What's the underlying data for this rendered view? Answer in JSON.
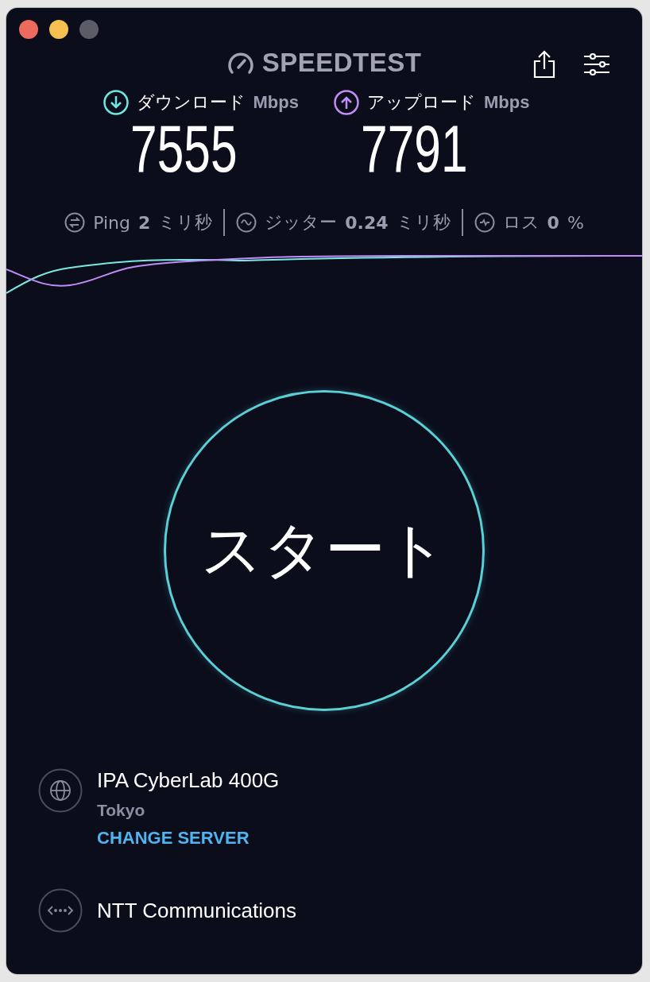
{
  "logo": {
    "text": "SPEEDTEST"
  },
  "metrics": [
    {
      "kind": "download",
      "label": "ダウンロード",
      "unit": "Mbps",
      "value": "7555"
    },
    {
      "kind": "upload",
      "label": "アップロード",
      "unit": "Mbps",
      "value": "7791"
    }
  ],
  "stats": [
    {
      "kind": "ping",
      "label": "Ping",
      "value": "2",
      "unit": "ミリ秒"
    },
    {
      "kind": "jitter",
      "label": "ジッター",
      "value": "0.24",
      "unit": "ミリ秒"
    },
    {
      "kind": "loss",
      "label": "ロス",
      "value": "0",
      "unit": "%"
    }
  ],
  "start_button": {
    "label": "スタート"
  },
  "server": {
    "name": "IPA CyberLab 400G",
    "location": "Tokyo",
    "change_link": "CHANGE SERVER"
  },
  "provider": {
    "name": "NTT Communications"
  }
}
